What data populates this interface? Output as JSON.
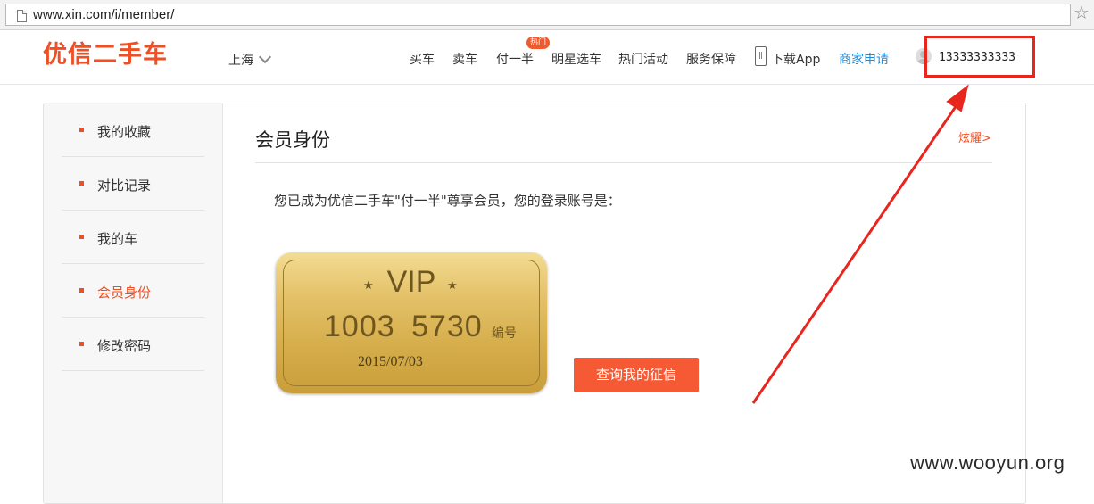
{
  "browser": {
    "url": "www.xin.com/i/member/"
  },
  "header": {
    "logo": "优信二手车",
    "city": "上海",
    "nav": [
      "买车",
      "卖车",
      "付一半",
      "明星选车",
      "热门活动",
      "服务保障",
      "下载App",
      "商家申请"
    ],
    "hot_badge": "热门",
    "user_phone": "13333333333"
  },
  "sidebar": {
    "items": [
      {
        "label": "我的收藏"
      },
      {
        "label": "对比记录"
      },
      {
        "label": "我的车"
      },
      {
        "label": "会员身份"
      },
      {
        "label": "修改密码"
      }
    ],
    "active_index": 3
  },
  "content": {
    "title": "会员身份",
    "flaunt_link": "炫耀>",
    "notice": "您已成为优信二手车\"付一半\"尊享会员，您的登录账号是：",
    "vip_card": {
      "title": "VIP",
      "number": "1003 5730",
      "number_tag": "编号",
      "date": "2015/07/03"
    },
    "credit_button": "查询我的征信"
  },
  "watermark": "www.wooyun.org",
  "colors": {
    "accent": "#f04e23",
    "button": "#f55a35",
    "highlight": "#e8261e",
    "link_blue": "#1c8ad6"
  }
}
